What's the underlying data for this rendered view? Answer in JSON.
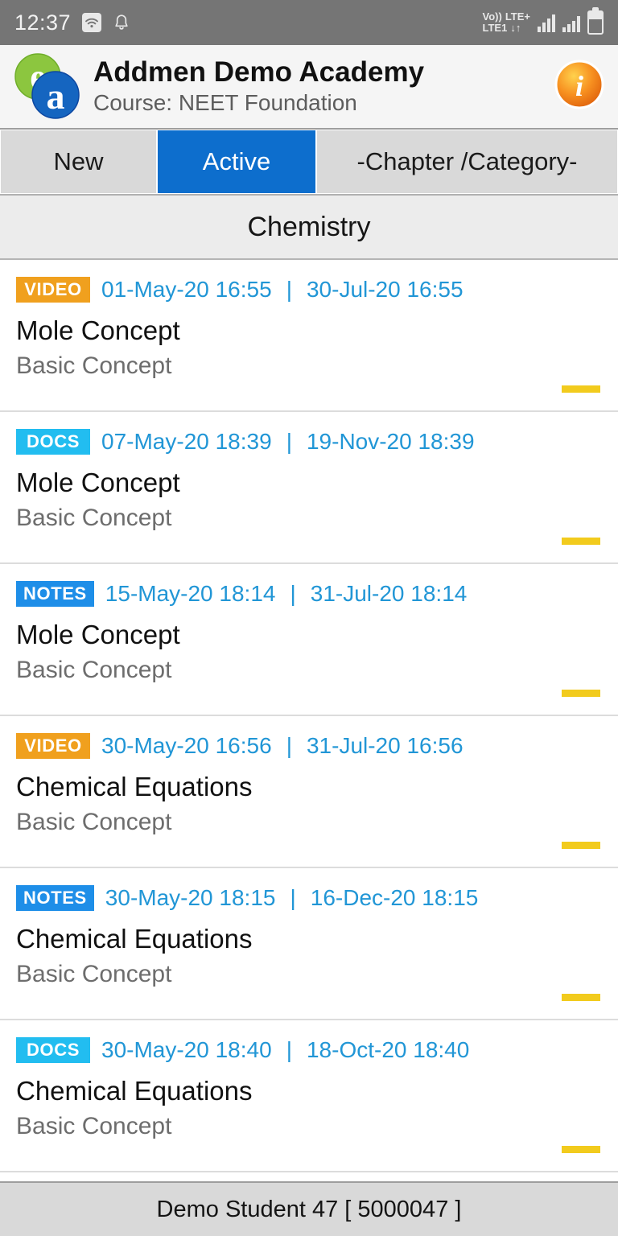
{
  "status_bar": {
    "time": "12:37",
    "wifi_icon": "wifi-icon",
    "bell_icon": "bell-icon",
    "volte_line1": "Vo))",
    "volte_line2": "LTE1",
    "lte_label": "LTE+",
    "data_arrows": "↓↑",
    "battery_icon": "battery-icon"
  },
  "header": {
    "logo_icon": "ea-logo-icon",
    "title": "Addmen Demo Academy",
    "subtitle": "Course: NEET Foundation",
    "info_icon": "info-icon"
  },
  "tabs": [
    {
      "label": "New",
      "active": false
    },
    {
      "label": "Active",
      "active": true
    },
    {
      "label": "-Chapter /Category-",
      "active": false
    }
  ],
  "section": {
    "title": "Chemistry"
  },
  "list": [
    {
      "badge": "VIDEO",
      "badge_type": "video",
      "start_date": "01-May-20 16:55",
      "separator": "|",
      "end_date": "30-Jul-20 16:55",
      "title": "Mole Concept",
      "subtitle": "Basic Concept"
    },
    {
      "badge": "DOCS",
      "badge_type": "docs",
      "start_date": "07-May-20 18:39",
      "separator": "|",
      "end_date": "19-Nov-20 18:39",
      "title": "Mole Concept",
      "subtitle": "Basic Concept"
    },
    {
      "badge": "NOTES",
      "badge_type": "notes",
      "start_date": "15-May-20 18:14",
      "separator": "|",
      "end_date": "31-Jul-20 18:14",
      "title": "Mole Concept",
      "subtitle": "Basic Concept"
    },
    {
      "badge": "VIDEO",
      "badge_type": "video",
      "start_date": "30-May-20 16:56",
      "separator": "|",
      "end_date": "31-Jul-20 16:56",
      "title": "Chemical Equations",
      "subtitle": "Basic Concept"
    },
    {
      "badge": "NOTES",
      "badge_type": "notes",
      "start_date": "30-May-20 18:15",
      "separator": "|",
      "end_date": "16-Dec-20 18:15",
      "title": "Chemical Equations",
      "subtitle": "Basic Concept"
    },
    {
      "badge": "DOCS",
      "badge_type": "docs",
      "start_date": "30-May-20 18:40",
      "separator": "|",
      "end_date": "18-Oct-20 18:40",
      "title": "Chemical Equations",
      "subtitle": "Basic Concept"
    }
  ],
  "footer": {
    "text": "Demo Student 47 [ 5000047 ]"
  },
  "colors": {
    "accent_blue": "#0d6ecd",
    "date_blue": "#2196d6",
    "badge_video": "#f0a01e",
    "badge_docs": "#22bdf0",
    "badge_notes": "#1e8ee8",
    "accent_yellow": "#f2cb1d",
    "status_bar_gray": "#757575"
  }
}
